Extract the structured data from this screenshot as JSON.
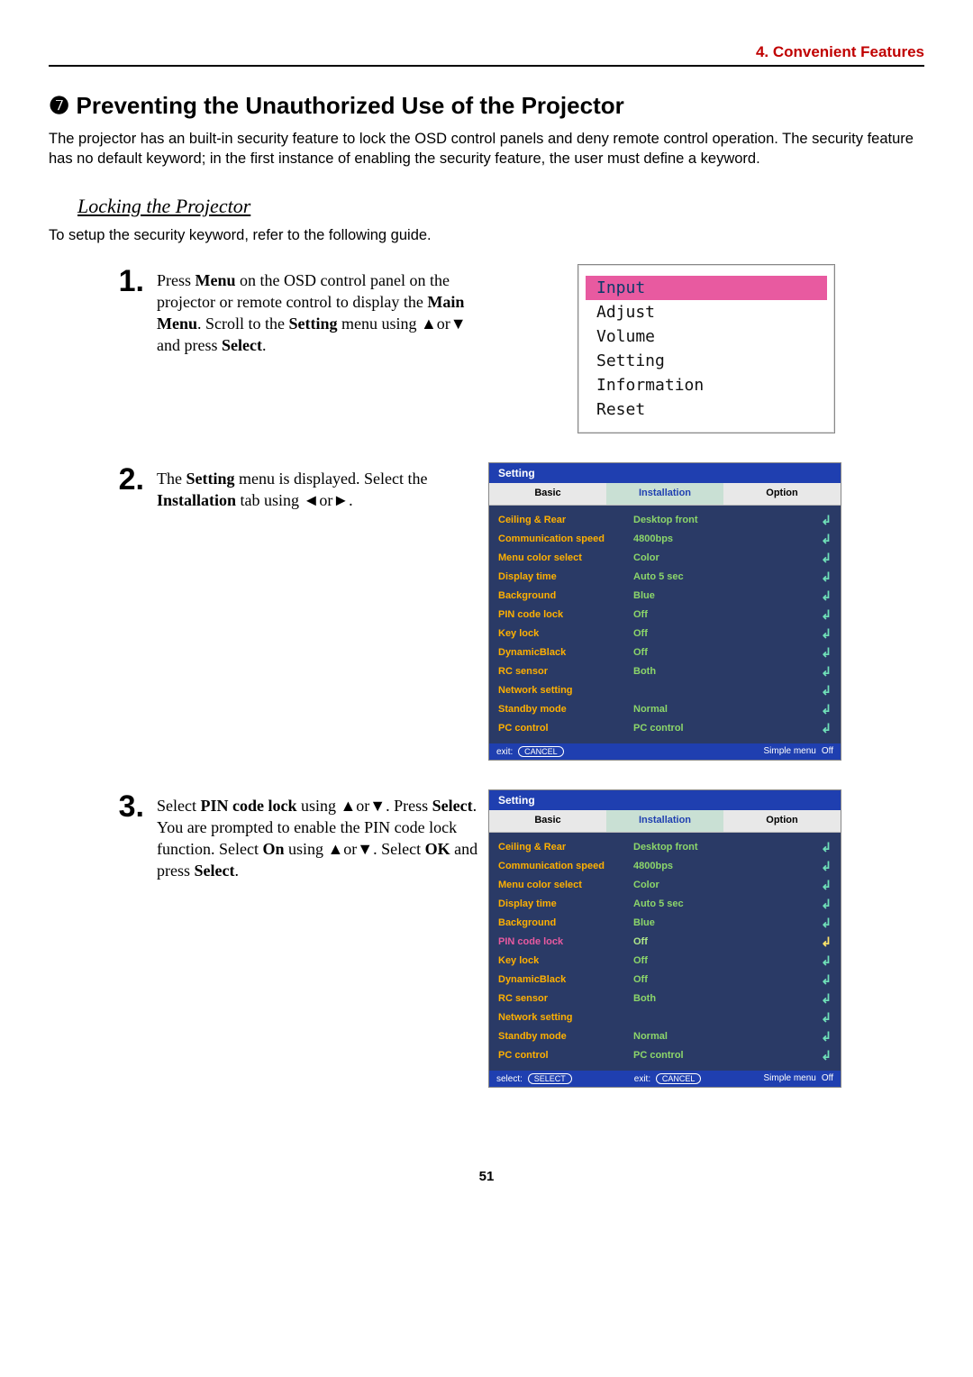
{
  "header": {
    "section": "4. Convenient Features"
  },
  "title": "❼ Preventing the Unauthorized Use of the Projector",
  "intro": "The projector has an built-in security feature to lock the OSD control panels and deny remote control operation. The security feature has no default keyword; in the first instance of enabling the security feature, the user must define a keyword.",
  "subheading": "Locking the Projector",
  "setup_line": "To setup the security keyword, refer to the following guide.",
  "steps": {
    "s1": {
      "num": "1.",
      "pre": "Press ",
      "b1": "Menu",
      "mid1": " on the OSD control panel on the projector or remote control to display the ",
      "b2": "Main Menu",
      "mid2": ". Scroll to the ",
      "b3": "Setting",
      "mid3": " menu using ▲or▼ and press ",
      "b4": "Select",
      "post": "."
    },
    "s2": {
      "num": "2.",
      "pre": "The ",
      "b1": "Setting",
      "mid1": " menu is displayed. Select the ",
      "b2": "Installation",
      "mid2": " tab using ◄or►."
    },
    "s3": {
      "num": "3.",
      "pre": "Select ",
      "b1": "PIN code lock",
      "mid1": " using ▲or▼. Press ",
      "b2": "Select",
      "mid2": ". You are prompted to enable the PIN code lock function. Select ",
      "b3": "On",
      "mid3": " using ▲or▼. Select ",
      "b4": "OK",
      "mid4": " and press ",
      "b5": "Select",
      "post": "."
    }
  },
  "fig1_menu": {
    "items": [
      "Input",
      "Adjust",
      "Volume",
      "Setting",
      "Information",
      "Reset"
    ],
    "selected_index": 0
  },
  "osd_shared": {
    "title": "Setting",
    "tabs": [
      "Basic",
      "Installation",
      "Option"
    ],
    "active_tab": 1,
    "footer_exit": "exit:",
    "footer_exit_btn": "CANCEL",
    "footer_select": "select:",
    "footer_select_btn": "SELECT",
    "footer_simple": "Simple menu",
    "footer_simple_val": "Off"
  },
  "osd_rows": [
    {
      "label": "Ceiling & Rear",
      "value": "Desktop front",
      "enter": "↲"
    },
    {
      "label": "Communication speed",
      "value": "4800bps",
      "enter": "↲"
    },
    {
      "label": "Menu color select",
      "value": "Color",
      "enter": "↲"
    },
    {
      "label": "Display time",
      "value": "Auto  5 sec",
      "enter": "↲"
    },
    {
      "label": "Background",
      "value": "Blue",
      "enter": "↲"
    },
    {
      "label": "PIN code lock",
      "value": "Off",
      "enter": "↲"
    },
    {
      "label": "Key lock",
      "value": "Off",
      "enter": "↲"
    },
    {
      "label": "DynamicBlack",
      "value": "Off",
      "enter": "↲"
    },
    {
      "label": "RC sensor",
      "value": "Both",
      "enter": "↲"
    },
    {
      "label": "Network setting",
      "value": "",
      "enter": "↲"
    },
    {
      "label": "Standby mode",
      "value": "Normal",
      "enter": "↲"
    },
    {
      "label": "PC control",
      "value": "PC control",
      "enter": "↲"
    }
  ],
  "osd_panel2_highlight": -1,
  "osd_panel3_highlight": 5,
  "page_number": "51"
}
